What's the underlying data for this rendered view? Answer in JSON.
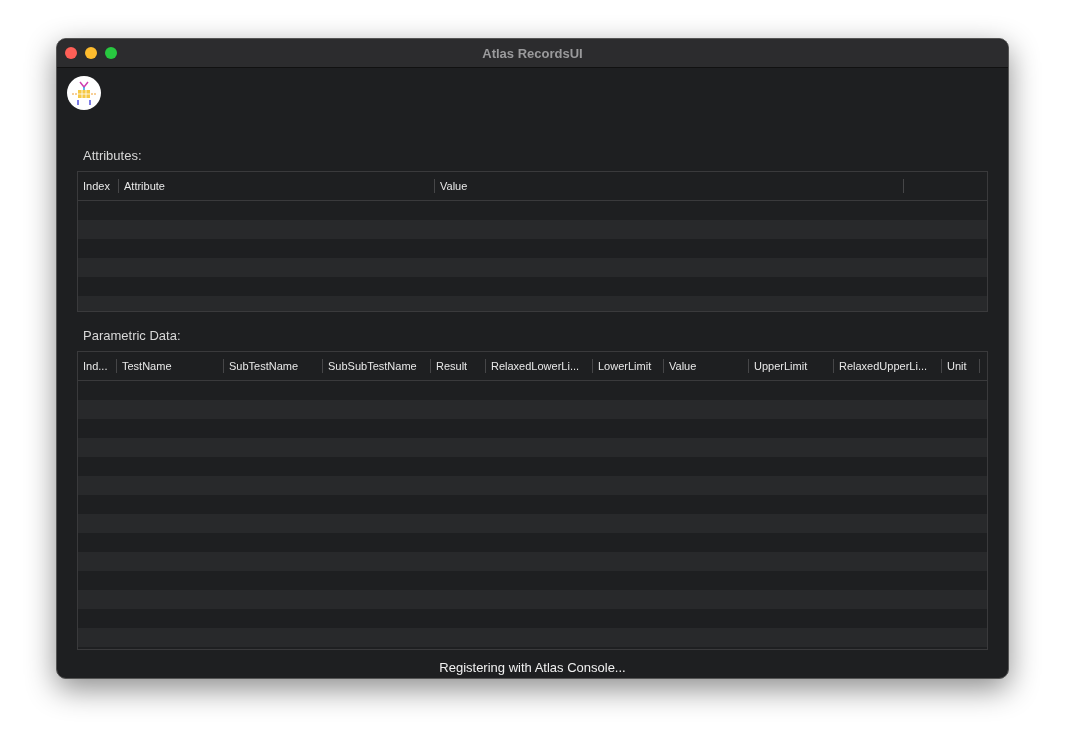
{
  "window": {
    "title": "Atlas RecordsUI"
  },
  "attributes": {
    "label": "Attributes:",
    "columns": [
      "Index",
      "Attribute",
      "Value"
    ]
  },
  "parametric_data": {
    "label": "Parametric Data:",
    "columns": [
      "Ind...",
      "TestName",
      "SubTestName",
      "SubSubTestName",
      "Result",
      "RelaxedLowerLi...",
      "LowerLimit",
      "Value",
      "UpperLimit",
      "RelaxedUpperLi...",
      "Unit"
    ]
  },
  "status_bar": {
    "text": "Registering with Atlas Console..."
  }
}
